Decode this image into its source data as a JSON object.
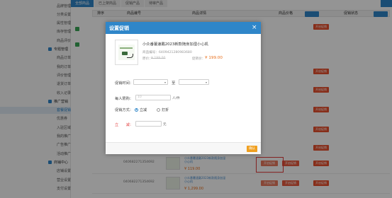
{
  "sidebar": {
    "items": [
      {
        "label": "品牌管理",
        "kind": "sub"
      },
      {
        "label": "分类设置",
        "kind": "sub"
      },
      {
        "label": "属性管理",
        "kind": "sub"
      },
      {
        "label": "库存管理",
        "kind": "sub"
      },
      {
        "label": "商品评价",
        "kind": "sub"
      },
      {
        "label": "专题管理",
        "kind": "group"
      },
      {
        "label": "商品订单",
        "kind": "sub"
      },
      {
        "label": "我的订单",
        "kind": "sub"
      },
      {
        "label": "评价管理",
        "kind": "sub"
      },
      {
        "label": "退货订单",
        "kind": "sub"
      },
      {
        "label": "收入记录",
        "kind": "sub"
      },
      {
        "label": "推广营销",
        "kind": "group"
      },
      {
        "label": "套餐促销",
        "kind": "sub",
        "active": true
      },
      {
        "label": "优惠券",
        "kind": "sub"
      },
      {
        "label": "入驻区域管理",
        "kind": "sub"
      },
      {
        "label": "我的推广商品",
        "kind": "sub"
      },
      {
        "label": "广告推广",
        "kind": "sub"
      },
      {
        "label": "活动推广",
        "kind": "sub"
      },
      {
        "label": "商铺中心",
        "kind": "group"
      },
      {
        "label": "店铺设置",
        "kind": "sub"
      },
      {
        "label": "营业设置",
        "kind": "sub"
      },
      {
        "label": "支付设置",
        "kind": "sub"
      }
    ]
  },
  "tabs": [
    {
      "label": "全部商品",
      "active": true
    },
    {
      "label": "已上架商品",
      "active": false
    },
    {
      "label": "促销产品",
      "active": false
    },
    {
      "label": "待审产品",
      "active": false
    }
  ],
  "table": {
    "headers": {
      "c1": "排序",
      "c2": "商品编号",
      "c3": "商品详情",
      "c4": "商品价格",
      "c5": "促销状态"
    },
    "rows": [
      {
        "code": "040682271354692",
        "name": "小众番薯速戴2023新款随身加湿小心机",
        "price": "¥ 119.00",
        "b1": "开启促销",
        "b2": "开启促销",
        "b3": "开启促销"
      },
      {
        "code": "040682271354692",
        "name": "小众番薯速戴2023新款随身加湿小心机",
        "price": "¥ 1,299.00",
        "b1": "开启促销",
        "b2": "开启促销",
        "b3": "开启促销"
      }
    ],
    "side_buttons": [
      "开启促销",
      "开启促销",
      "开启促销",
      "开启促销",
      "开启促销",
      "开启促销"
    ]
  },
  "modal": {
    "title": "设置促销",
    "close": "×",
    "product": {
      "name": "小众番薯速戴2023新款随身加湿小心机",
      "code_label": "商品编号：",
      "code": "6409421280983680",
      "orig_label": "原价：",
      "orig_price": "¥ 199.00",
      "promo_label": "促销价：",
      "promo_price": "¥ 199.00"
    },
    "time_label": "促销时间：",
    "range_sep": "至",
    "limit_label": "每人限购：",
    "limit_placeholder": "10",
    "limit_unit": "人/件",
    "method_label": "促销方式：",
    "method_options": [
      {
        "label": "立减",
        "selected": true
      },
      {
        "label": "打折",
        "selected": false
      }
    ],
    "reduce_label": "立　　减：",
    "reduce_unit": "元",
    "confirm": "确认"
  }
}
